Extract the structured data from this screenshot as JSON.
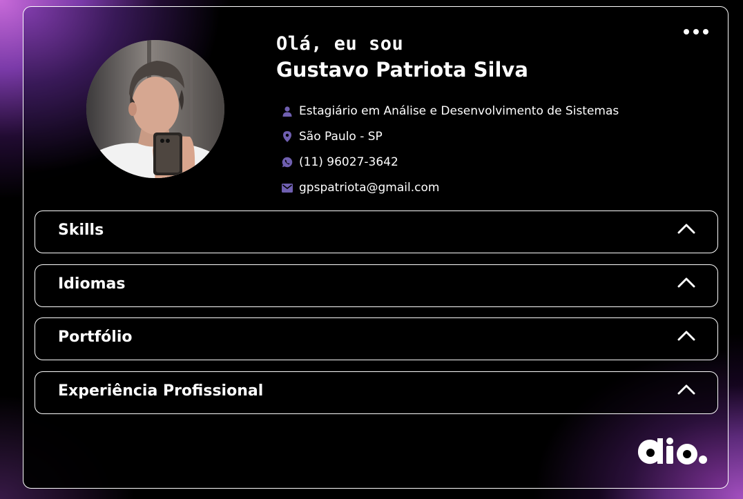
{
  "profile": {
    "greeting": "Olá, eu sou",
    "name": "Gustavo Patriota Silva",
    "info": [
      {
        "icon": "user-icon",
        "text": "Estagiário em Análise e Desenvolvimento de Sistemas"
      },
      {
        "icon": "location-pin-icon",
        "text": "São Paulo - SP"
      },
      {
        "icon": "whatsapp-icon",
        "text": "(11) 96027-3642"
      },
      {
        "icon": "mail-icon",
        "text": "gpspatriota@gmail.com"
      }
    ]
  },
  "accordions": [
    {
      "label": "Skills"
    },
    {
      "label": "Idiomas"
    },
    {
      "label": "Portfólio"
    },
    {
      "label": "Experiência Profissional"
    }
  ],
  "icons": {
    "menu": "more-horizontal-icon",
    "chevron": "chevron-up-icon",
    "logo": "dio-logo"
  },
  "colors": {
    "accent_purple": "#6f5fb0",
    "gradient_purple": "#c86ad9",
    "border": "#ffffff",
    "background": "#000000"
  }
}
